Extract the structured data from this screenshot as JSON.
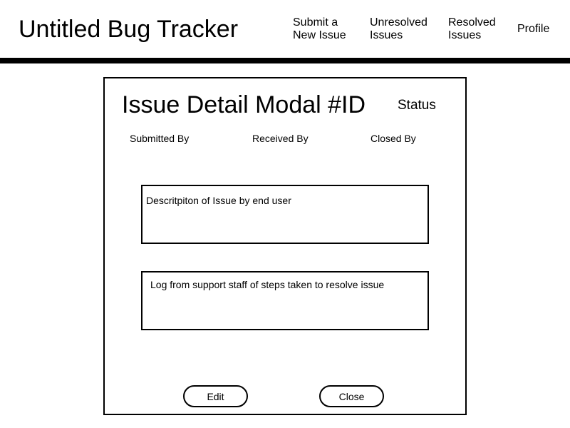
{
  "header": {
    "title": "Untitled Bug Tracker",
    "nav": [
      {
        "line1": "Submit a",
        "line2": "New Issue"
      },
      {
        "line1": "Unresolved",
        "line2": "Issues"
      },
      {
        "line1": "Resolved",
        "line2": "Issues"
      },
      {
        "line1": "Profile",
        "line2": ""
      }
    ]
  },
  "modal": {
    "title": "Issue Detail Modal #ID",
    "status": "Status",
    "submitted_by": "Submitted By",
    "received_by": "Received By",
    "closed_by": "Closed By",
    "description": "Descritpiton of Issue by end user",
    "log": "Log from support staff of steps taken to resolve issue",
    "edit_label": "Edit",
    "close_label": "Close"
  }
}
